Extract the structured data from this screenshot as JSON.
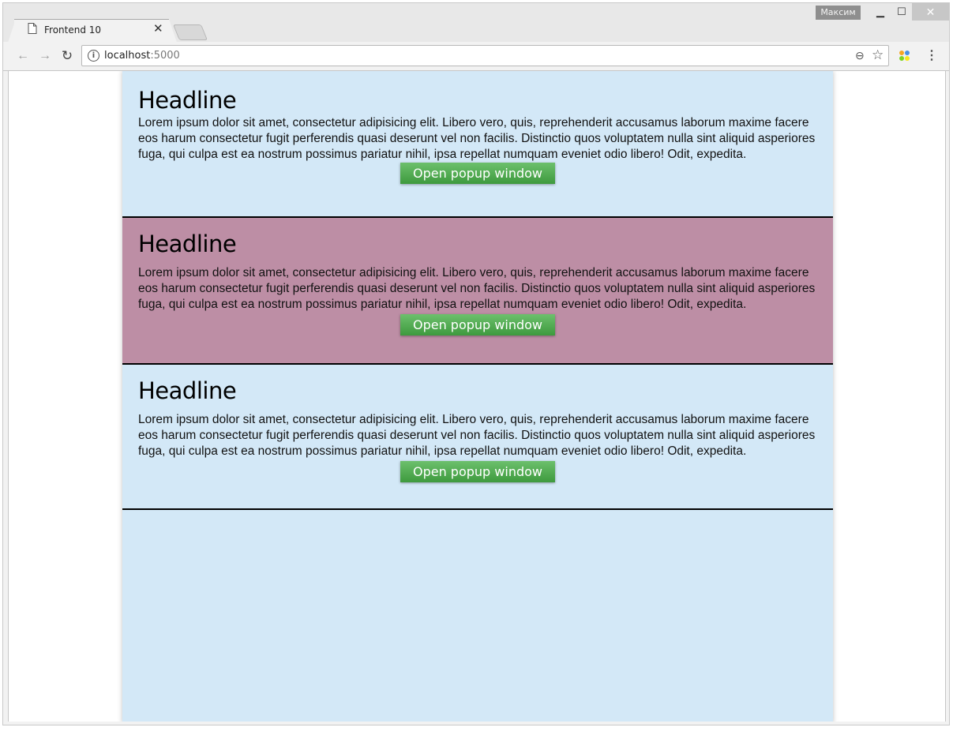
{
  "browser": {
    "tab_title": "Frontend 10",
    "profile_name": "Максим",
    "url_host": "localhost",
    "url_port": ":5000"
  },
  "cards": [
    {
      "headline": "Headline",
      "body": "Lorem ipsum dolor sit amet, consectetur adipisicing elit. Libero vero, quis, reprehenderit accusamus laborum maxime facere eos harum consectetur fugit perferendis quasi deserunt vel non facilis. Distinctio quos voluptatem nulla sint aliquid asperiores fuga, qui culpa est ea nostrum possimus pariatur nihil, ipsa repellat numquam eveniet odio libero! Odit, expedita.",
      "button_label": "Open popup window"
    },
    {
      "headline": "Headline",
      "body": "Lorem ipsum dolor sit amet, consectetur adipisicing elit. Libero vero, quis, reprehenderit accusamus laborum maxime facere eos harum consectetur fugit perferendis quasi deserunt vel non facilis. Distinctio quos voluptatem nulla sint aliquid asperiores fuga, qui culpa est ea nostrum possimus pariatur nihil, ipsa repellat numquam eveniet odio libero! Odit, expedita.",
      "button_label": "Open popup window"
    },
    {
      "headline": "Headline",
      "body": "Lorem ipsum dolor sit amet, consectetur adipisicing elit. Libero vero, quis, reprehenderit accusamus laborum maxime facere eos harum consectetur fugit perferendis quasi deserunt vel non facilis. Distinctio quos voluptatem nulla sint aliquid asperiores fuga, qui culpa est ea nostrum possimus pariatur nihil, ipsa repellat numquam eveniet odio libero! Odit, expedita.",
      "button_label": "Open popup window"
    }
  ],
  "colors": {
    "card_blue": "#d3e8f7",
    "card_mauve": "#bd8ea5",
    "button_green": "#4caf50"
  },
  "icons": [
    "page-icon",
    "close-icon",
    "back-arrow-icon",
    "forward-arrow-icon",
    "reload-icon",
    "info-icon",
    "zoom-icon",
    "star-icon",
    "extension-icon",
    "menu-icon",
    "minimize-icon",
    "maximize-icon",
    "window-close-icon"
  ]
}
